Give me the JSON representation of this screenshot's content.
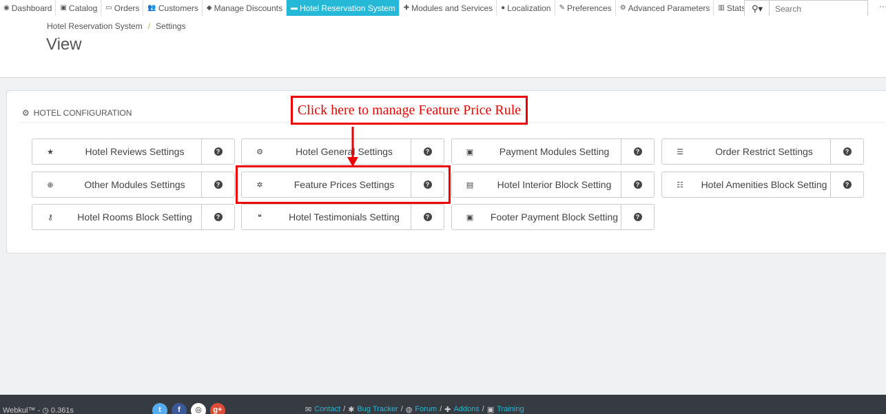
{
  "nav": {
    "items": [
      {
        "label": "Dashboard",
        "icon": "dashboard-icon",
        "glyph": "◉"
      },
      {
        "label": "Catalog",
        "icon": "book-icon",
        "glyph": "▣"
      },
      {
        "label": "Orders",
        "icon": "credit-card-icon",
        "glyph": "▭"
      },
      {
        "label": "Customers",
        "icon": "users-icon",
        "glyph": "👥"
      },
      {
        "label": "Manage Discounts",
        "icon": "tag-icon",
        "glyph": "◆"
      },
      {
        "label": "Hotel Reservation System",
        "icon": "bed-icon",
        "glyph": "▬"
      },
      {
        "label": "Modules and Services",
        "icon": "puzzle-icon",
        "glyph": "✚"
      },
      {
        "label": "Localization",
        "icon": "globe-icon",
        "glyph": "●"
      },
      {
        "label": "Preferences",
        "icon": "wrench-icon",
        "glyph": "✎"
      },
      {
        "label": "Advanced Parameters",
        "icon": "cogs-icon",
        "glyph": "⚙"
      },
      {
        "label": "Stats",
        "icon": "bar-chart-icon",
        "glyph": "▥"
      }
    ],
    "active_index": 5,
    "search_placeholder": "Search",
    "search_icon": "⚲▾",
    "more": "···"
  },
  "header": {
    "breadcrumb": [
      "Hotel Reservation System",
      "Settings"
    ],
    "breadcrumb_sep": "/",
    "title": "View"
  },
  "panel": {
    "heading": "Hotel Configuration",
    "heading_icon": "⚙",
    "tiles": [
      {
        "label": "Hotel Reviews Settings",
        "icon": "star-icon",
        "glyph": "★"
      },
      {
        "label": "Hotel General Settings",
        "icon": "cogs-icon",
        "glyph": "⚙"
      },
      {
        "label": "Payment Modules Setting",
        "icon": "money-icon",
        "glyph": "▣"
      },
      {
        "label": "Order Restrict Settings",
        "icon": "list-alt-icon",
        "glyph": "☰"
      },
      {
        "label": "Other Modules Settings",
        "icon": "life-ring-icon",
        "glyph": "⊕"
      },
      {
        "label": "Feature Prices Settings",
        "icon": "cog-icon",
        "glyph": "✲"
      },
      {
        "label": "Hotel Interior Block Setting",
        "icon": "file-icon",
        "glyph": "▤"
      },
      {
        "label": "Hotel Amenities Block Setting",
        "icon": "list-icon",
        "glyph": "☷"
      },
      {
        "label": "Hotel Rooms Block Setting",
        "icon": "key-icon",
        "glyph": "⚷"
      },
      {
        "label": "Hotel Testimonials Setting",
        "icon": "quote-icon",
        "glyph": "❝"
      },
      {
        "label": "Footer Payment Block Setting",
        "icon": "money-icon",
        "glyph": "▣"
      }
    ],
    "help_glyph": "?"
  },
  "annotation": {
    "text": "Click here to manage Feature Price Rule",
    "color": "#ee0000"
  },
  "footer": {
    "brand": "Webkul™ - ◷ 0.361s",
    "social": [
      {
        "icon": "twitter-icon",
        "glyph": "t",
        "color": "#55acee"
      },
      {
        "icon": "facebook-icon",
        "glyph": "f",
        "color": "#3b5998"
      },
      {
        "icon": "github-icon",
        "glyph": "◎",
        "color": "#ffffff"
      },
      {
        "icon": "google-plus-icon",
        "glyph": "g+",
        "color": "#dd4b39"
      }
    ],
    "links": [
      "Contact",
      "Bug Tracker",
      "Forum",
      "Addons",
      "Training"
    ]
  },
  "colors": {
    "accent": "#25b9d7",
    "annotation": "#ee0000",
    "footer_bg": "#363a41"
  }
}
